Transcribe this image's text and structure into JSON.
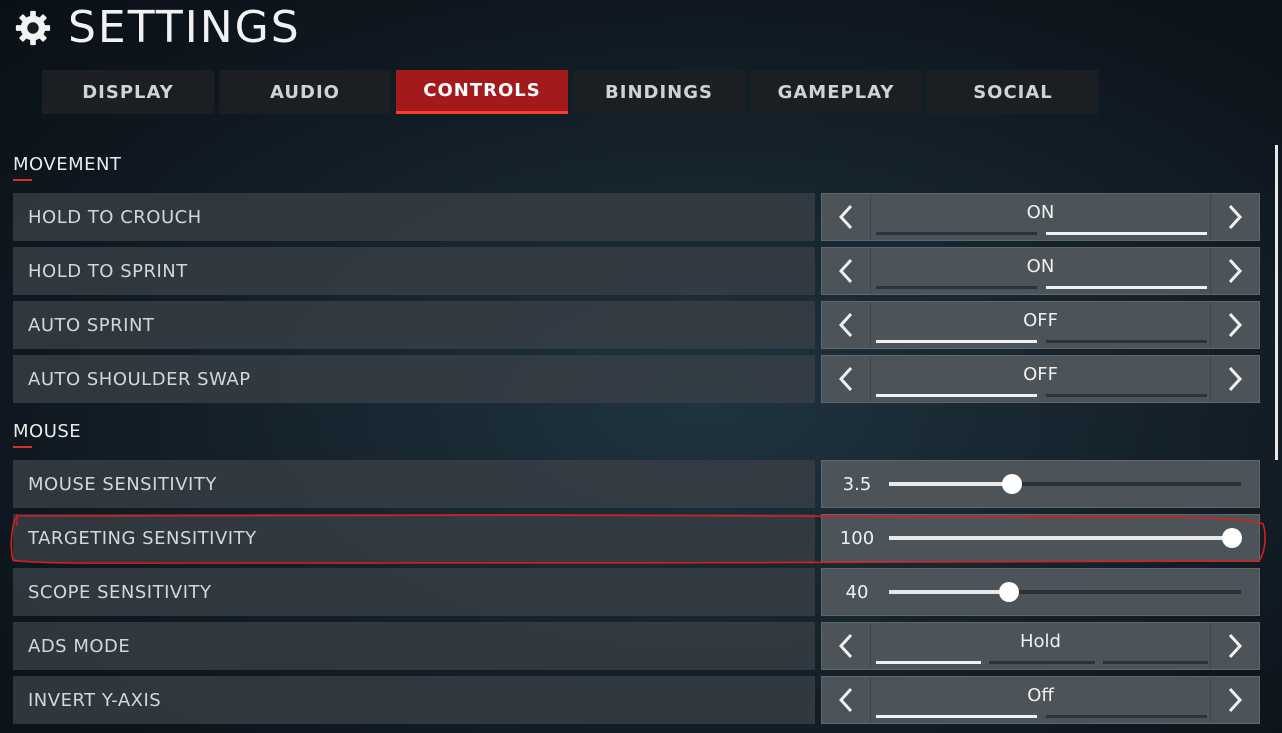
{
  "header": {
    "title": "SETTINGS",
    "icon": "gear-icon"
  },
  "tabs": [
    {
      "label": "DISPLAY",
      "active": false
    },
    {
      "label": "AUDIO",
      "active": false
    },
    {
      "label": "CONTROLS",
      "active": true
    },
    {
      "label": "BINDINGS",
      "active": false
    },
    {
      "label": "GAMEPLAY",
      "active": false
    },
    {
      "label": "SOCIAL",
      "active": false
    }
  ],
  "sections": {
    "movement": "MOVEMENT",
    "mouse": "MOUSE"
  },
  "rows": {
    "hold_to_crouch": {
      "label": "HOLD TO CROUCH",
      "value": "ON"
    },
    "hold_to_sprint": {
      "label": "HOLD TO SPRINT",
      "value": "ON"
    },
    "auto_sprint": {
      "label": "AUTO SPRINT",
      "value": "OFF"
    },
    "auto_shoulder_swap": {
      "label": "AUTO SHOULDER SWAP",
      "value": "OFF"
    },
    "mouse_sensitivity": {
      "label": "MOUSE SENSITIVITY",
      "value": "3.5",
      "fraction": 0.35
    },
    "targeting_sensitivity": {
      "label": "TARGETING SENSITIVITY",
      "value": "100",
      "fraction": 0.975
    },
    "scope_sensitivity": {
      "label": "SCOPE SENSITIVITY",
      "value": "40",
      "fraction": 0.34
    },
    "ads_mode": {
      "label": "ADS MODE",
      "value": "Hold"
    },
    "invert_y_axis": {
      "label": "INVERT Y-AXIS",
      "value": "Off"
    }
  },
  "colors": {
    "accent": "#a31a1a",
    "annotation": "#d81e1e"
  }
}
